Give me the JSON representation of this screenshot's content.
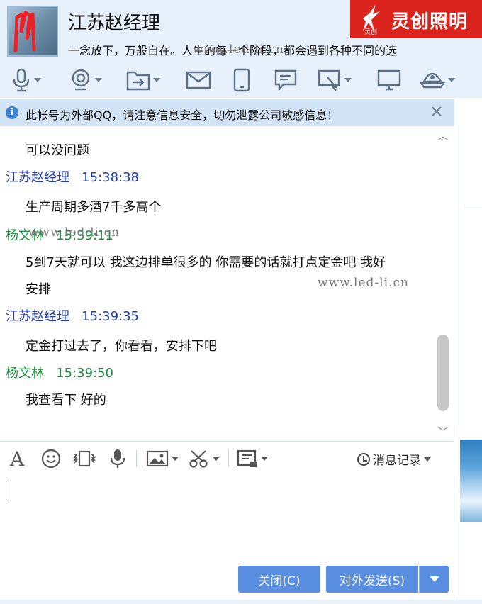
{
  "header": {
    "contact_name": "江苏赵经理",
    "signature": "一念放下，万般自在。人生的每一个阶段，都会遇到各种不同的选",
    "brand_logo_text": "灵创照明",
    "brand_logo_sub": "灵创"
  },
  "toolbar": {
    "icons": [
      "microphone-icon",
      "camera-icon",
      "file-transfer-icon",
      "mail-icon",
      "mobile-icon",
      "chat-bubble-icon",
      "screen-share-icon",
      "monitor-icon",
      "app-dock-icon"
    ]
  },
  "notice": {
    "text": "此帐号为外部QQ，请注意信息安全，切勿泄露公司敏感信息！",
    "close": "✕"
  },
  "messages": [
    {
      "text": "可以没问题"
    },
    {
      "sender": "江苏赵经理",
      "time": "15:38:38",
      "text": "生产周期多酒7千多高个"
    },
    {
      "sender": "杨文林",
      "time": "15:39:11",
      "text_line1": "5到7天就可以  我这边排单很多的 你需要的话就打点定金吧  我好",
      "text_line2": "安排"
    },
    {
      "sender": "江苏赵经理",
      "time": "15:39:35",
      "text": "定金打过去了，你看看，安排下吧"
    },
    {
      "sender": "杨文林",
      "time": "15:39:50",
      "text": "我查看下  好的"
    }
  ],
  "watermarks": [
    "www.led-li.cn",
    "www.led-li.cn",
    "www.led-li.cn"
  ],
  "input_toolbar": {
    "font_label": "A",
    "history_label": "消息记录"
  },
  "buttons": {
    "close": "关闭(C)",
    "send": "对外发送(S)"
  },
  "colors": {
    "header_bg": "#e6f0fb",
    "notice_bg": "#d3e3f6",
    "sender_self": "#1f3db0",
    "sender_other": "#1a8f3c",
    "button_bg": "#5a8ee0",
    "logo_bg": "#d9231c"
  }
}
